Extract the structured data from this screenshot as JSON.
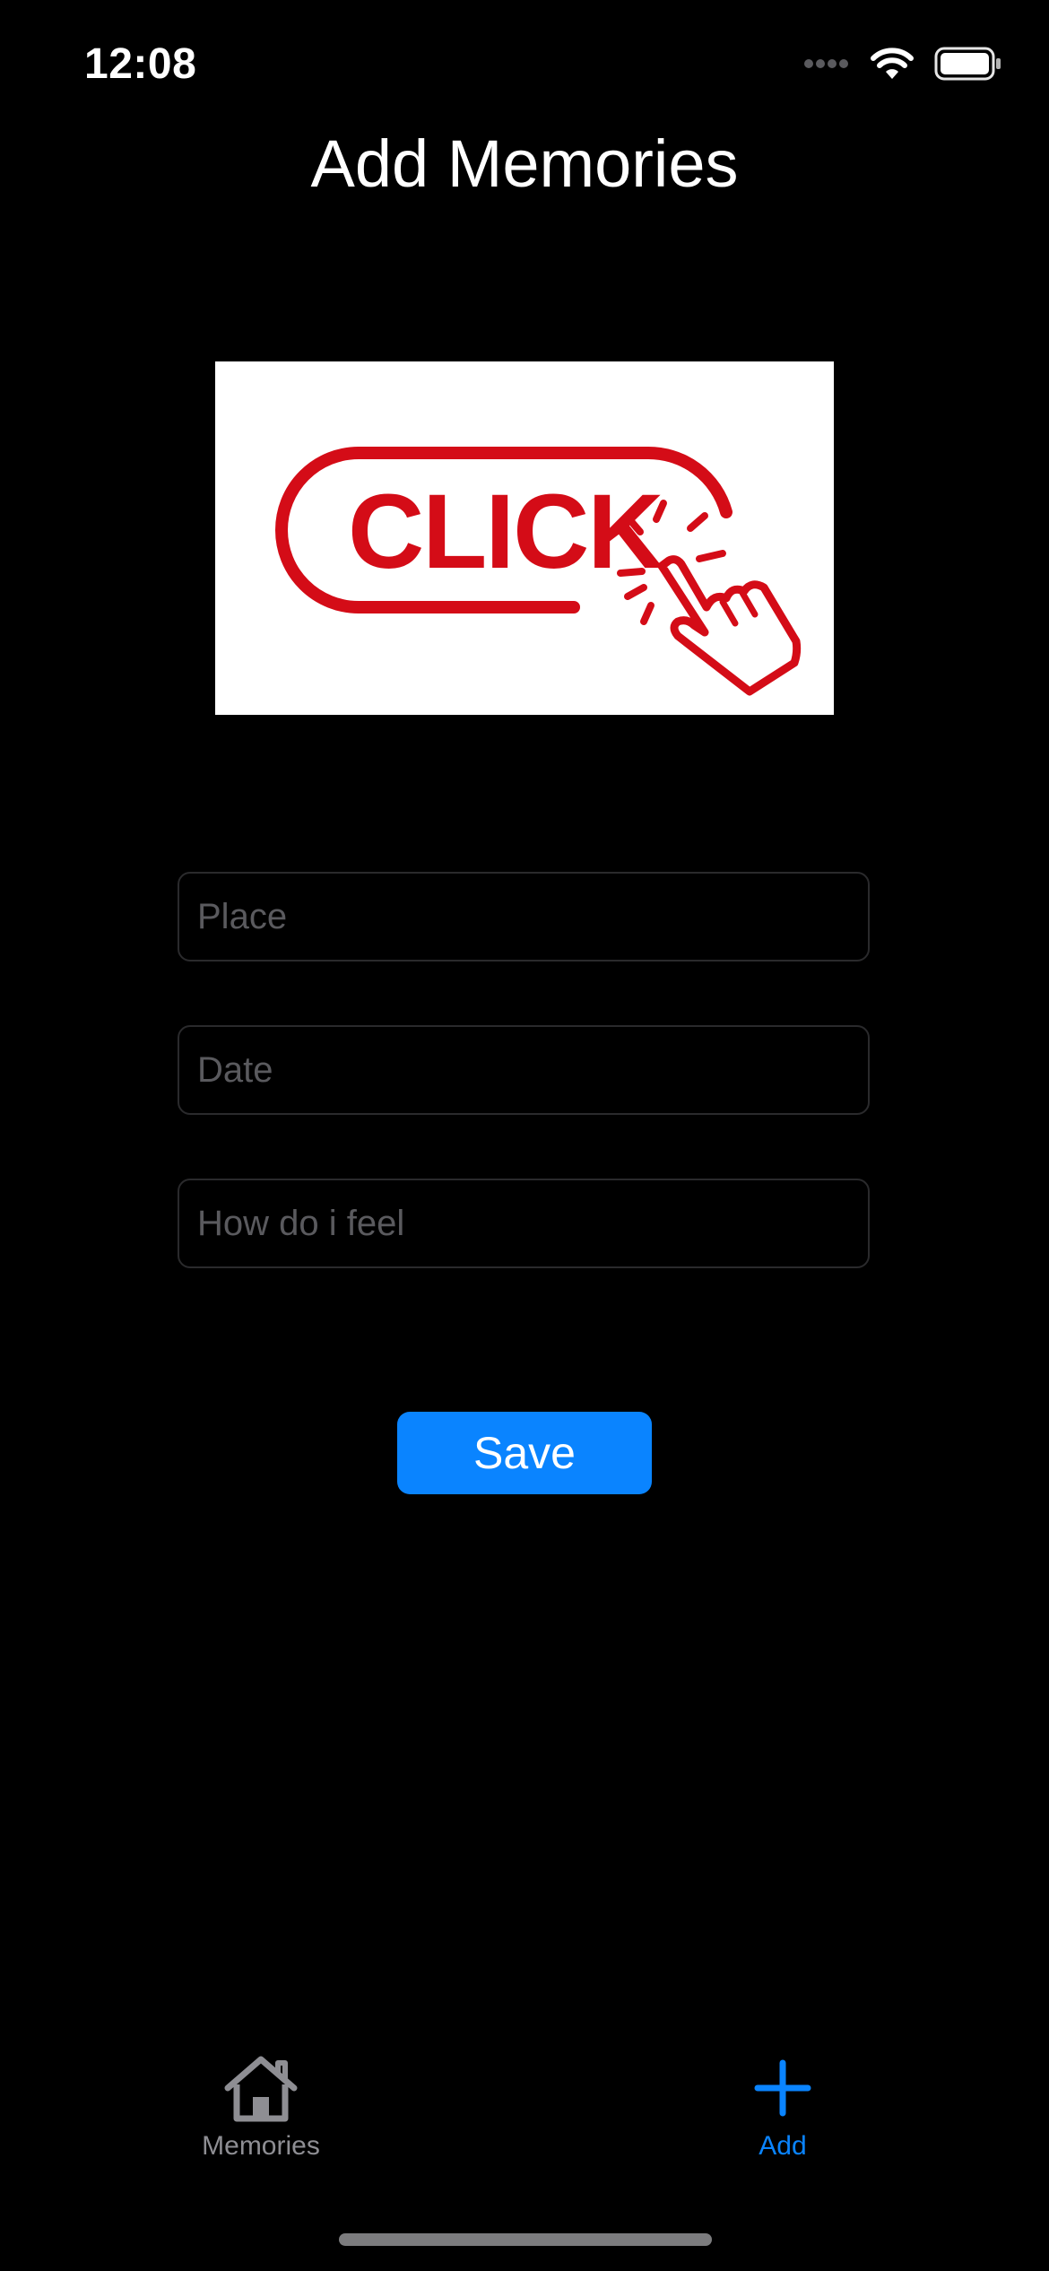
{
  "status_bar": {
    "time": "12:08",
    "icons": [
      "signal-dots-icon",
      "wifi-icon",
      "battery-icon"
    ]
  },
  "nav": {
    "title": "Add Memories"
  },
  "image_picker": {
    "image_text": "CLICK",
    "icon": "click-hand-icon",
    "accent_color": "#d40c17"
  },
  "form": {
    "place_placeholder": "Place",
    "place_value": "",
    "date_placeholder": "Date",
    "date_value": "",
    "feel_placeholder": "How do i feel",
    "feel_value": "",
    "save_label": "Save"
  },
  "tab_bar": {
    "tabs": [
      {
        "label": "Memories",
        "icon": "house-icon",
        "selected": false,
        "color": "#8e8e93"
      },
      {
        "label": "Add",
        "icon": "plus-icon",
        "selected": true,
        "color": "#0a84ff"
      }
    ]
  },
  "colors": {
    "background": "#000000",
    "accent": "#0a84ff"
  }
}
